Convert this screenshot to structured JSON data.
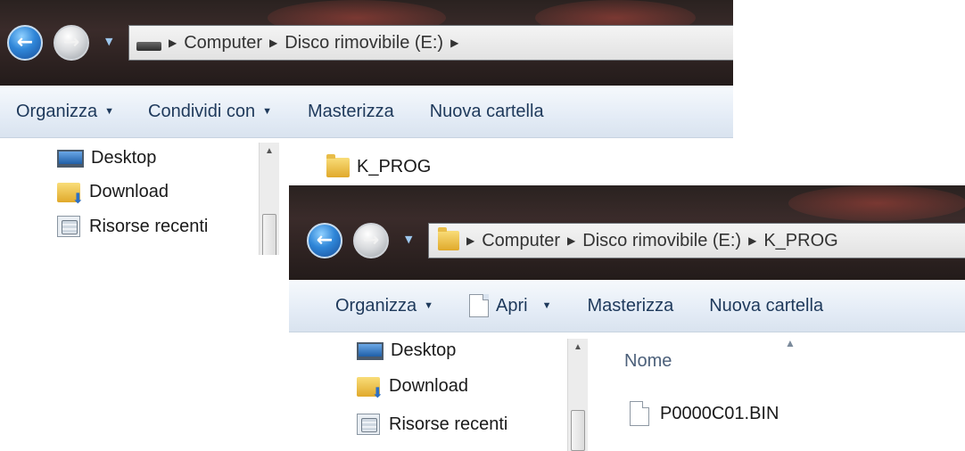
{
  "window_back": {
    "address_bar": {
      "breadcrumbs": [
        "Computer",
        "Disco rimovibile (E:)"
      ],
      "drive_icon": "removable-drive-icon"
    },
    "toolbar": {
      "organize_label": "Organizza",
      "share_label": "Condividi con",
      "burn_label": "Masterizza",
      "new_folder_label": "Nuova cartella"
    },
    "nav_pane": {
      "items": [
        {
          "label": "Desktop",
          "icon": "desktop-icon"
        },
        {
          "label": "Download",
          "icon": "downloads-folder-icon"
        },
        {
          "label": "Risorse recenti",
          "icon": "recent-places-icon"
        }
      ]
    },
    "content": {
      "items": [
        {
          "name": "K_PROG",
          "icon": "folder-icon"
        }
      ]
    }
  },
  "window_front": {
    "address_bar": {
      "breadcrumbs": [
        "Computer",
        "Disco rimovibile (E:)",
        "K_PROG"
      ],
      "folder_icon": "folder-icon"
    },
    "toolbar": {
      "organize_label": "Organizza",
      "open_label": "Apri",
      "burn_label": "Masterizza",
      "new_folder_label": "Nuova cartella"
    },
    "nav_pane": {
      "items": [
        {
          "label": "Desktop",
          "icon": "desktop-icon"
        },
        {
          "label": "Download",
          "icon": "downloads-folder-icon"
        },
        {
          "label": "Risorse recenti",
          "icon": "recent-places-icon"
        }
      ]
    },
    "content": {
      "column_header": "Nome",
      "items": [
        {
          "name": "P0000C01.BIN",
          "icon": "file-icon"
        }
      ]
    }
  },
  "colors": {
    "titlebar_dark": "#2a2220",
    "toolbar_text": "#1e395b",
    "toolbar_bg": "#e4ecf6",
    "back_button_blue": "#2f86d8"
  }
}
